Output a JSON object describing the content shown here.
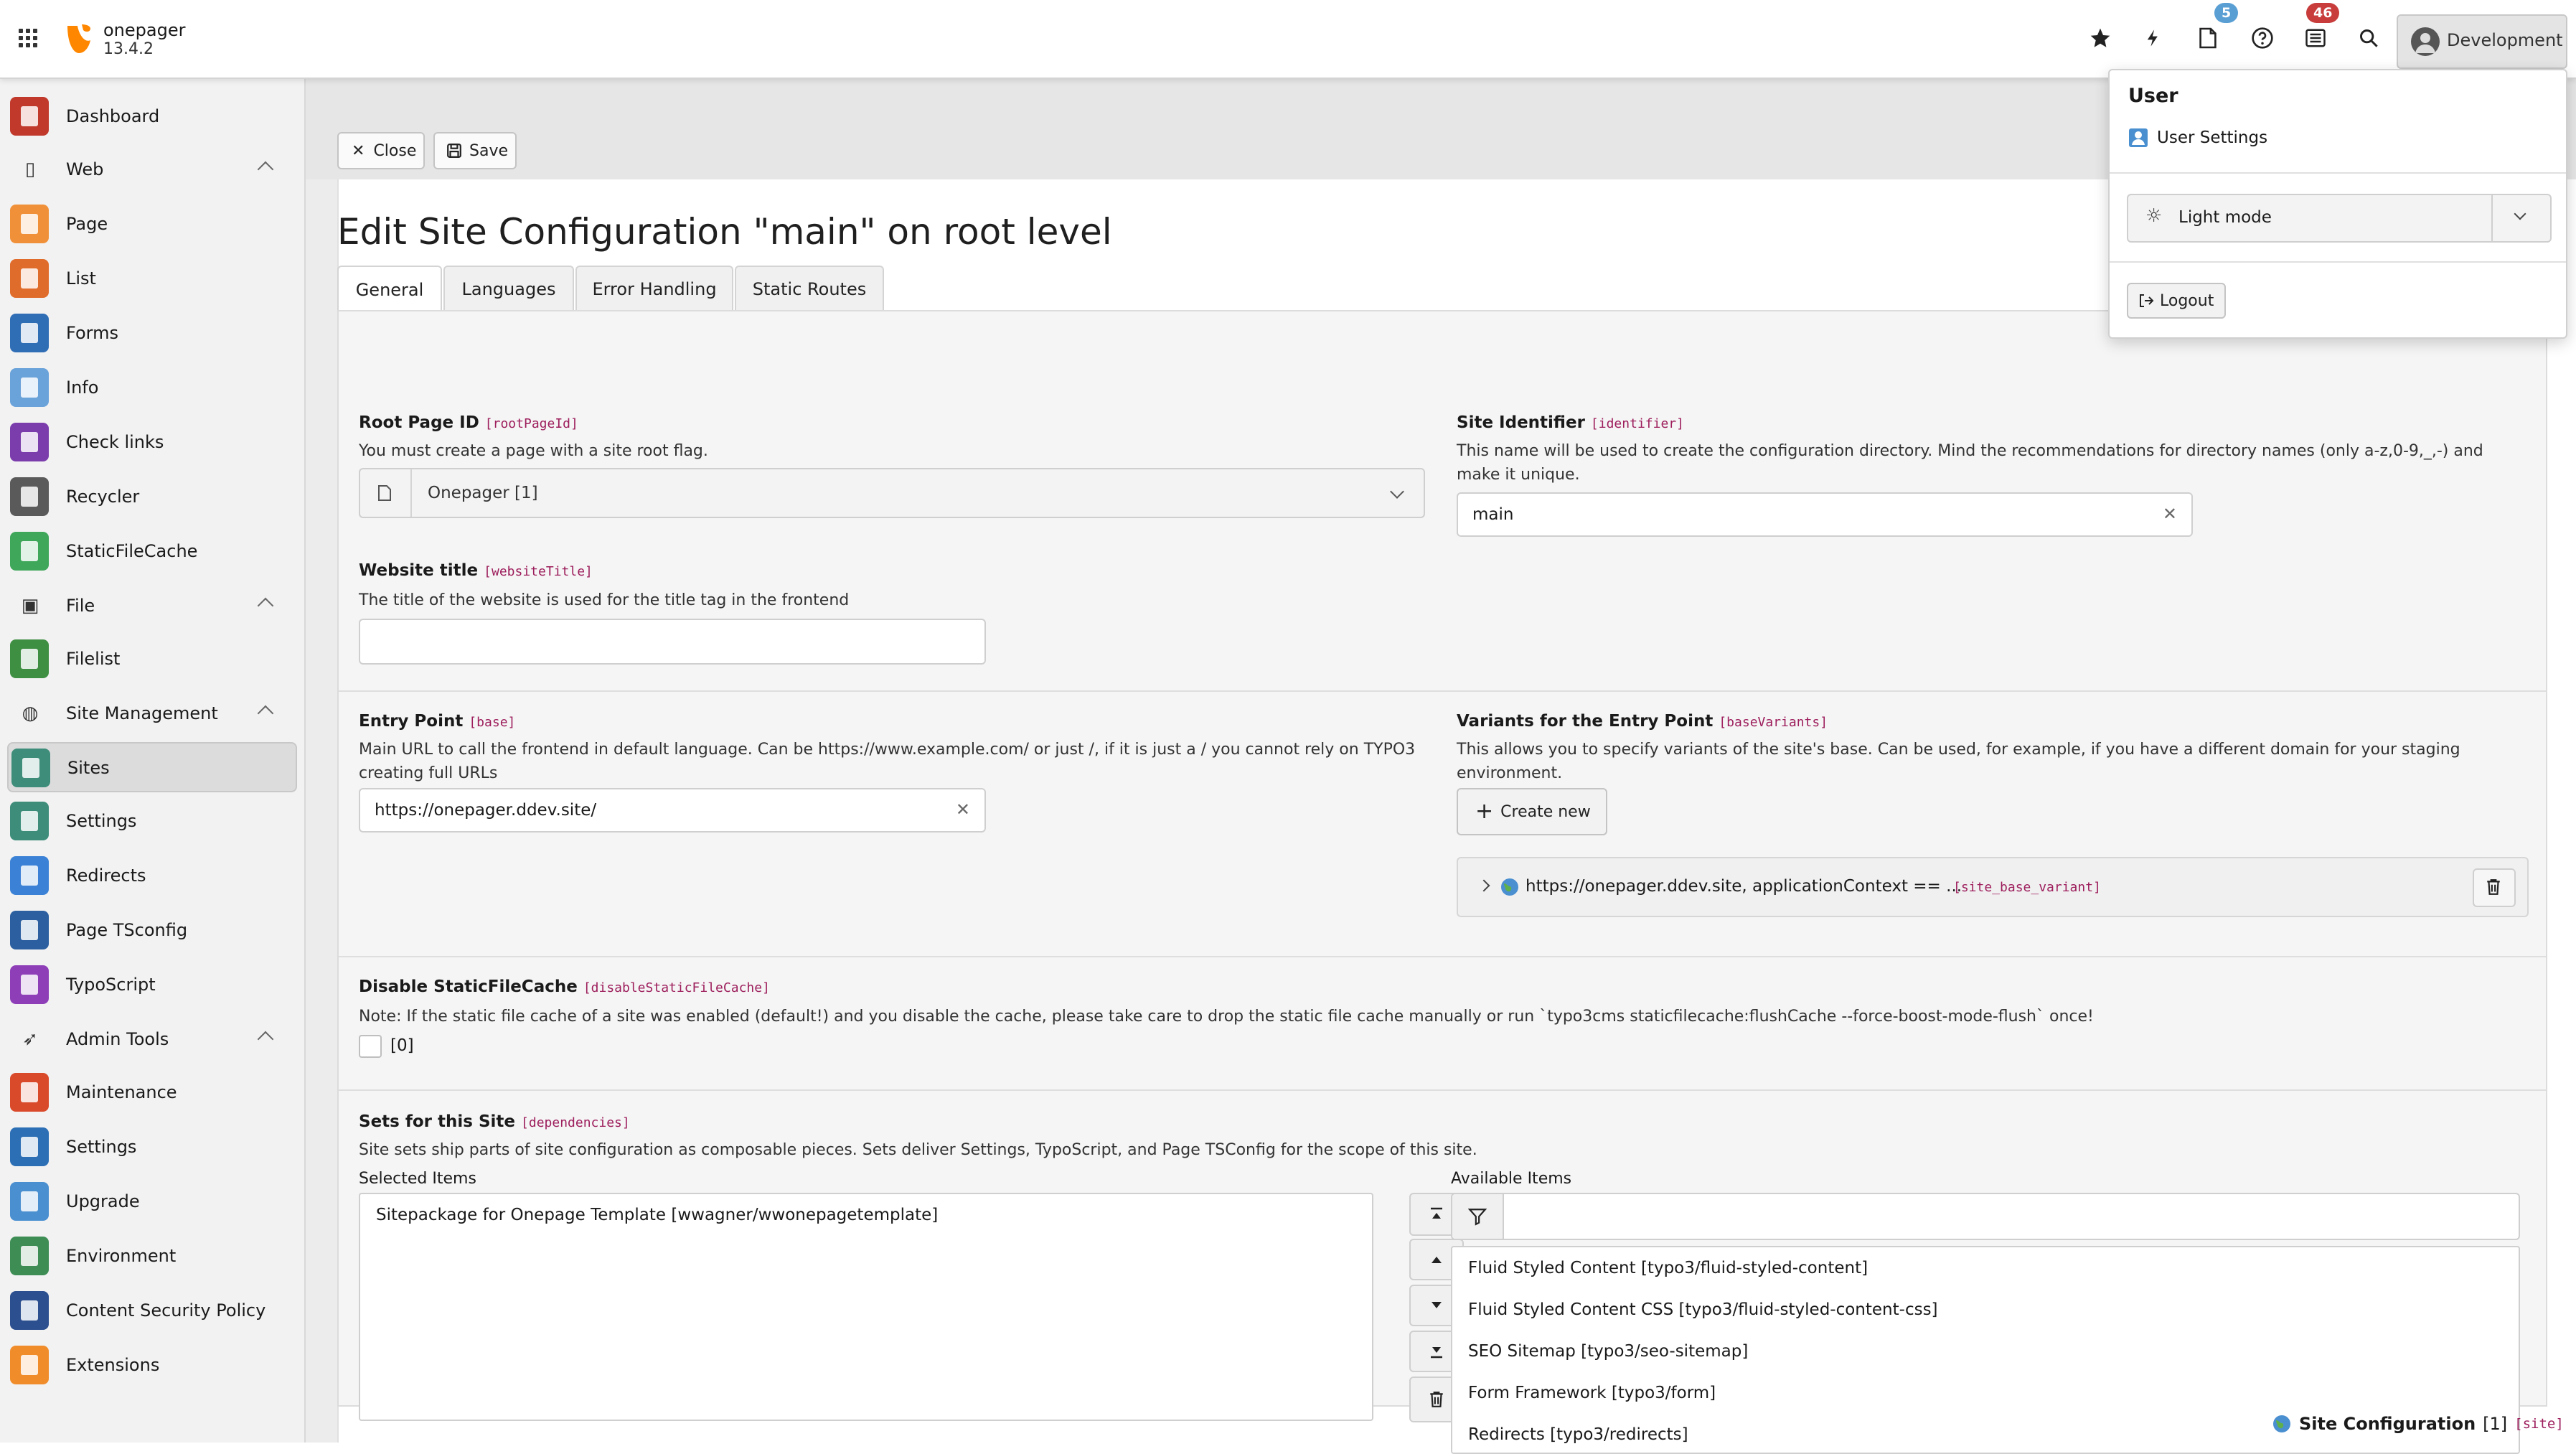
{
  "app": {
    "name": "onepager",
    "version": "13.4.2"
  },
  "topbar": {
    "bookmarks_icon": "star-icon",
    "flash_icon": "bolt-icon",
    "opendocs_badge": "5",
    "help_icon": "help-icon",
    "system_info_badge": "46",
    "search_icon": "search-icon",
    "user_label": "Development"
  },
  "colors": {
    "brand": "#ff8700",
    "badge_blue": "#5a9fd4",
    "badge_red": "#c83c3c",
    "mono_accent": "#9d1e5c"
  },
  "sidebar": {
    "items": [
      {
        "type": "module",
        "label": "Dashboard",
        "color": "#c0392b"
      },
      {
        "type": "group",
        "label": "Web"
      },
      {
        "type": "module",
        "label": "Page",
        "color": "#f0913a"
      },
      {
        "type": "module",
        "label": "List",
        "color": "#e06c2b"
      },
      {
        "type": "module",
        "label": "Forms",
        "color": "#2f6db5"
      },
      {
        "type": "module",
        "label": "Info",
        "color": "#6aa2da"
      },
      {
        "type": "module",
        "label": "Check links",
        "color": "#7a3dab"
      },
      {
        "type": "module",
        "label": "Recycler",
        "color": "#5a5a5a"
      },
      {
        "type": "module",
        "label": "StaticFileCache",
        "color": "#3ea75a"
      },
      {
        "type": "group",
        "label": "File"
      },
      {
        "type": "module",
        "label": "Filelist",
        "color": "#3f8f43"
      },
      {
        "type": "group",
        "label": "Site Management"
      },
      {
        "type": "module",
        "label": "Sites",
        "color": "#3d8d7a",
        "active": true
      },
      {
        "type": "module",
        "label": "Settings",
        "color": "#3d8d7a"
      },
      {
        "type": "module",
        "label": "Redirects",
        "color": "#3b82d6"
      },
      {
        "type": "module",
        "label": "Page TSconfig",
        "color": "#2c5fa0"
      },
      {
        "type": "module",
        "label": "TypoScript",
        "color": "#8e3fb8"
      },
      {
        "type": "group",
        "label": "Admin Tools"
      },
      {
        "type": "module",
        "label": "Maintenance",
        "color": "#d94a2b"
      },
      {
        "type": "module",
        "label": "Settings",
        "color": "#2c6fb5"
      },
      {
        "type": "module",
        "label": "Upgrade",
        "color": "#4a8fd0"
      },
      {
        "type": "module",
        "label": "Environment",
        "color": "#3d8d55"
      },
      {
        "type": "module",
        "label": "Content Security Policy",
        "color": "#2c4f8f"
      },
      {
        "type": "module",
        "label": "Extensions",
        "color": "#f08c2a"
      }
    ]
  },
  "docheader": {
    "close_label": "Close",
    "save_label": "Save"
  },
  "page": {
    "title": "Edit Site Configuration \"main\" on root level",
    "tabs": [
      "General",
      "Languages",
      "Error Handling",
      "Static Routes"
    ]
  },
  "form": {
    "root_page": {
      "label": "Root Page ID",
      "key": "[rootPageId]",
      "desc": "You must create a page with a site root flag.",
      "value": "Onepager [1]"
    },
    "identifier": {
      "label": "Site Identifier",
      "key": "[identifier]",
      "desc": "This name will be used to create the configuration directory. Mind the recommendations for directory names (only a-z,0-9,_,-) and make it unique.",
      "value": "main"
    },
    "website_title": {
      "label": "Website title",
      "key": "[websiteTitle]",
      "desc": "The title of the website is used for the title tag in the frontend",
      "value": ""
    },
    "entry_point": {
      "label": "Entry Point",
      "key": "[base]",
      "desc": "Main URL to call the frontend in default language. Can be https://www.example.com/ or just /, if it is just a / you cannot rely on TYPO3 creating full URLs",
      "value": "https://onepager.ddev.site/"
    },
    "variants": {
      "label": "Variants for the Entry Point",
      "key": "[baseVariants]",
      "desc": "This allows you to specify variants of the site's base. Can be used, for example, if you have a different domain for your staging environment.",
      "create_label": "Create new",
      "record_title": "https://onepager.ddev.site, applicationContext == ...",
      "record_table": "[site_base_variant]"
    },
    "disable_sfc": {
      "label": "Disable StaticFileCache",
      "key": "[disableStaticFileCache]",
      "desc": "Note: If the static file cache of a site was enabled (default!) and you disable the cache, please take care to drop the static file cache manually or run `typo3cms staticfilecache:flushCache --force-boost-mode-flush` once!",
      "value_label": "[0]"
    },
    "sets": {
      "label": "Sets for this Site",
      "key": "[dependencies]",
      "desc": "Site sets ship parts of site configuration as composable pieces. Sets deliver Settings, TypoScript, and Page TSConfig for the scope of this site.",
      "selected_label": "Selected Items",
      "available_label": "Available Items",
      "selected": [
        "Sitepackage for Onepage Template [wwagner/wwonepagetemplate]"
      ],
      "available": [
        "Fluid Styled Content [typo3/fluid-styled-content]",
        "Fluid Styled Content CSS [typo3/fluid-styled-content-css]",
        "SEO Sitemap [typo3/seo-sitemap]",
        "Form Framework [typo3/form]",
        "Redirects [typo3/redirects]"
      ],
      "filter_placeholder": ""
    }
  },
  "footer": {
    "record": "Site Configuration",
    "uid": "[1]",
    "table": "[site]"
  },
  "user_dropdown": {
    "heading": "User",
    "settings_label": "User Settings",
    "mode_label": "Light mode",
    "logout_label": "Logout"
  }
}
